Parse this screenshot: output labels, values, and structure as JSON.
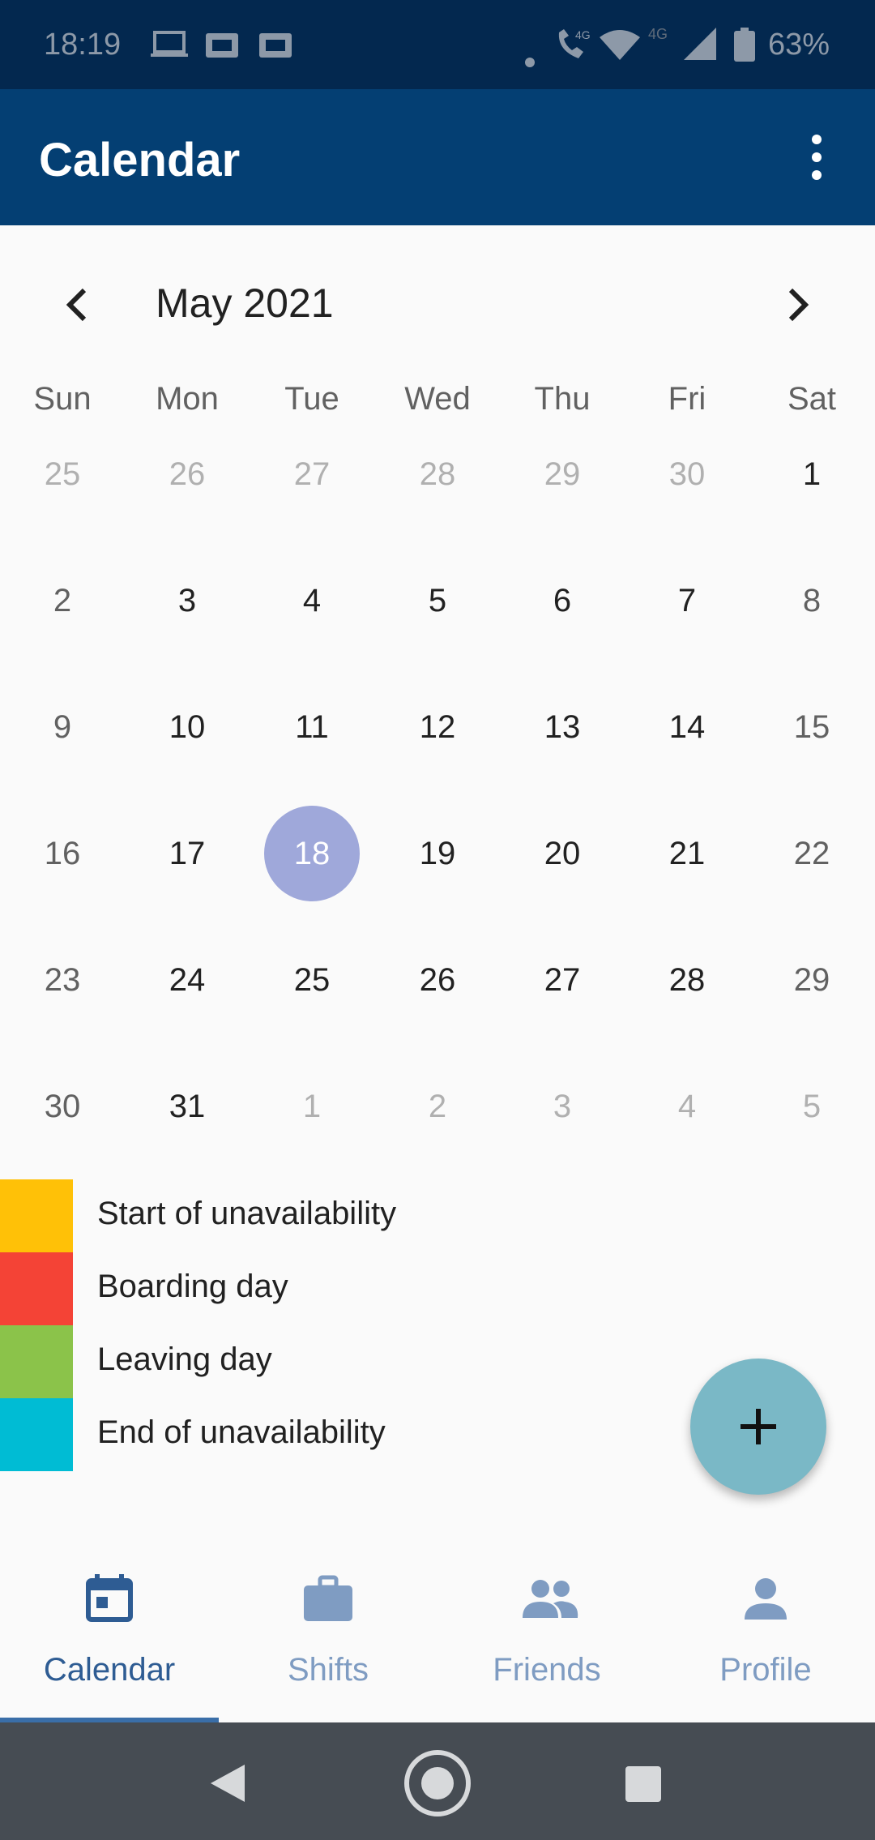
{
  "status_bar": {
    "time": "18:19",
    "battery_percent": "63%",
    "icons": [
      "laptop-icon",
      "sim-card-icon",
      "sim-card-icon",
      "dot-icon",
      "volte-call-icon",
      "wifi-icon",
      "signal-4g-icon",
      "battery-icon"
    ],
    "network_label": "4G"
  },
  "app_bar": {
    "title": "Calendar",
    "menu_icon": "more-vertical-icon",
    "background_color": "#043f73"
  },
  "calendar": {
    "month_label": "May 2021",
    "prev_icon": "chevron-left-icon",
    "next_icon": "chevron-right-icon",
    "weekdays": [
      "Sun",
      "Mon",
      "Tue",
      "Wed",
      "Thu",
      "Fri",
      "Sat"
    ],
    "weeks": [
      [
        "25",
        "26",
        "27",
        "28",
        "29",
        "30",
        "1"
      ],
      [
        "2",
        "3",
        "4",
        "5",
        "6",
        "7",
        "8"
      ],
      [
        "9",
        "10",
        "11",
        "12",
        "13",
        "14",
        "15"
      ],
      [
        "16",
        "17",
        "18",
        "19",
        "20",
        "21",
        "22"
      ],
      [
        "23",
        "24",
        "25",
        "26",
        "27",
        "28",
        "29"
      ],
      [
        "30",
        "31",
        "1",
        "2",
        "3",
        "4",
        "5"
      ]
    ],
    "selected_day": "18",
    "selected_color": "#9fa8da"
  },
  "legend": [
    {
      "label": "Start of unavailability",
      "color": "#ffc107"
    },
    {
      "label": "Boarding day",
      "color": "#f44336"
    },
    {
      "label": "Leaving day",
      "color": "#8bc34a"
    },
    {
      "label": "End of unavailability",
      "color": "#00bcd4"
    }
  ],
  "fab": {
    "icon": "plus-icon",
    "color": "#7ab8c6"
  },
  "bottom_nav": {
    "tabs": [
      {
        "label": "Calendar",
        "icon": "calendar-icon",
        "active": true
      },
      {
        "label": "Shifts",
        "icon": "briefcase-icon",
        "active": false
      },
      {
        "label": "Friends",
        "icon": "people-icon",
        "active": false
      },
      {
        "label": "Profile",
        "icon": "person-icon",
        "active": false
      }
    ],
    "active_color": "#2e5c93",
    "inactive_color": "#7f9cc2"
  },
  "system_nav": {
    "back_icon": "back-triangle-icon",
    "home_icon": "home-circle-icon",
    "recents_icon": "recents-square-icon"
  }
}
